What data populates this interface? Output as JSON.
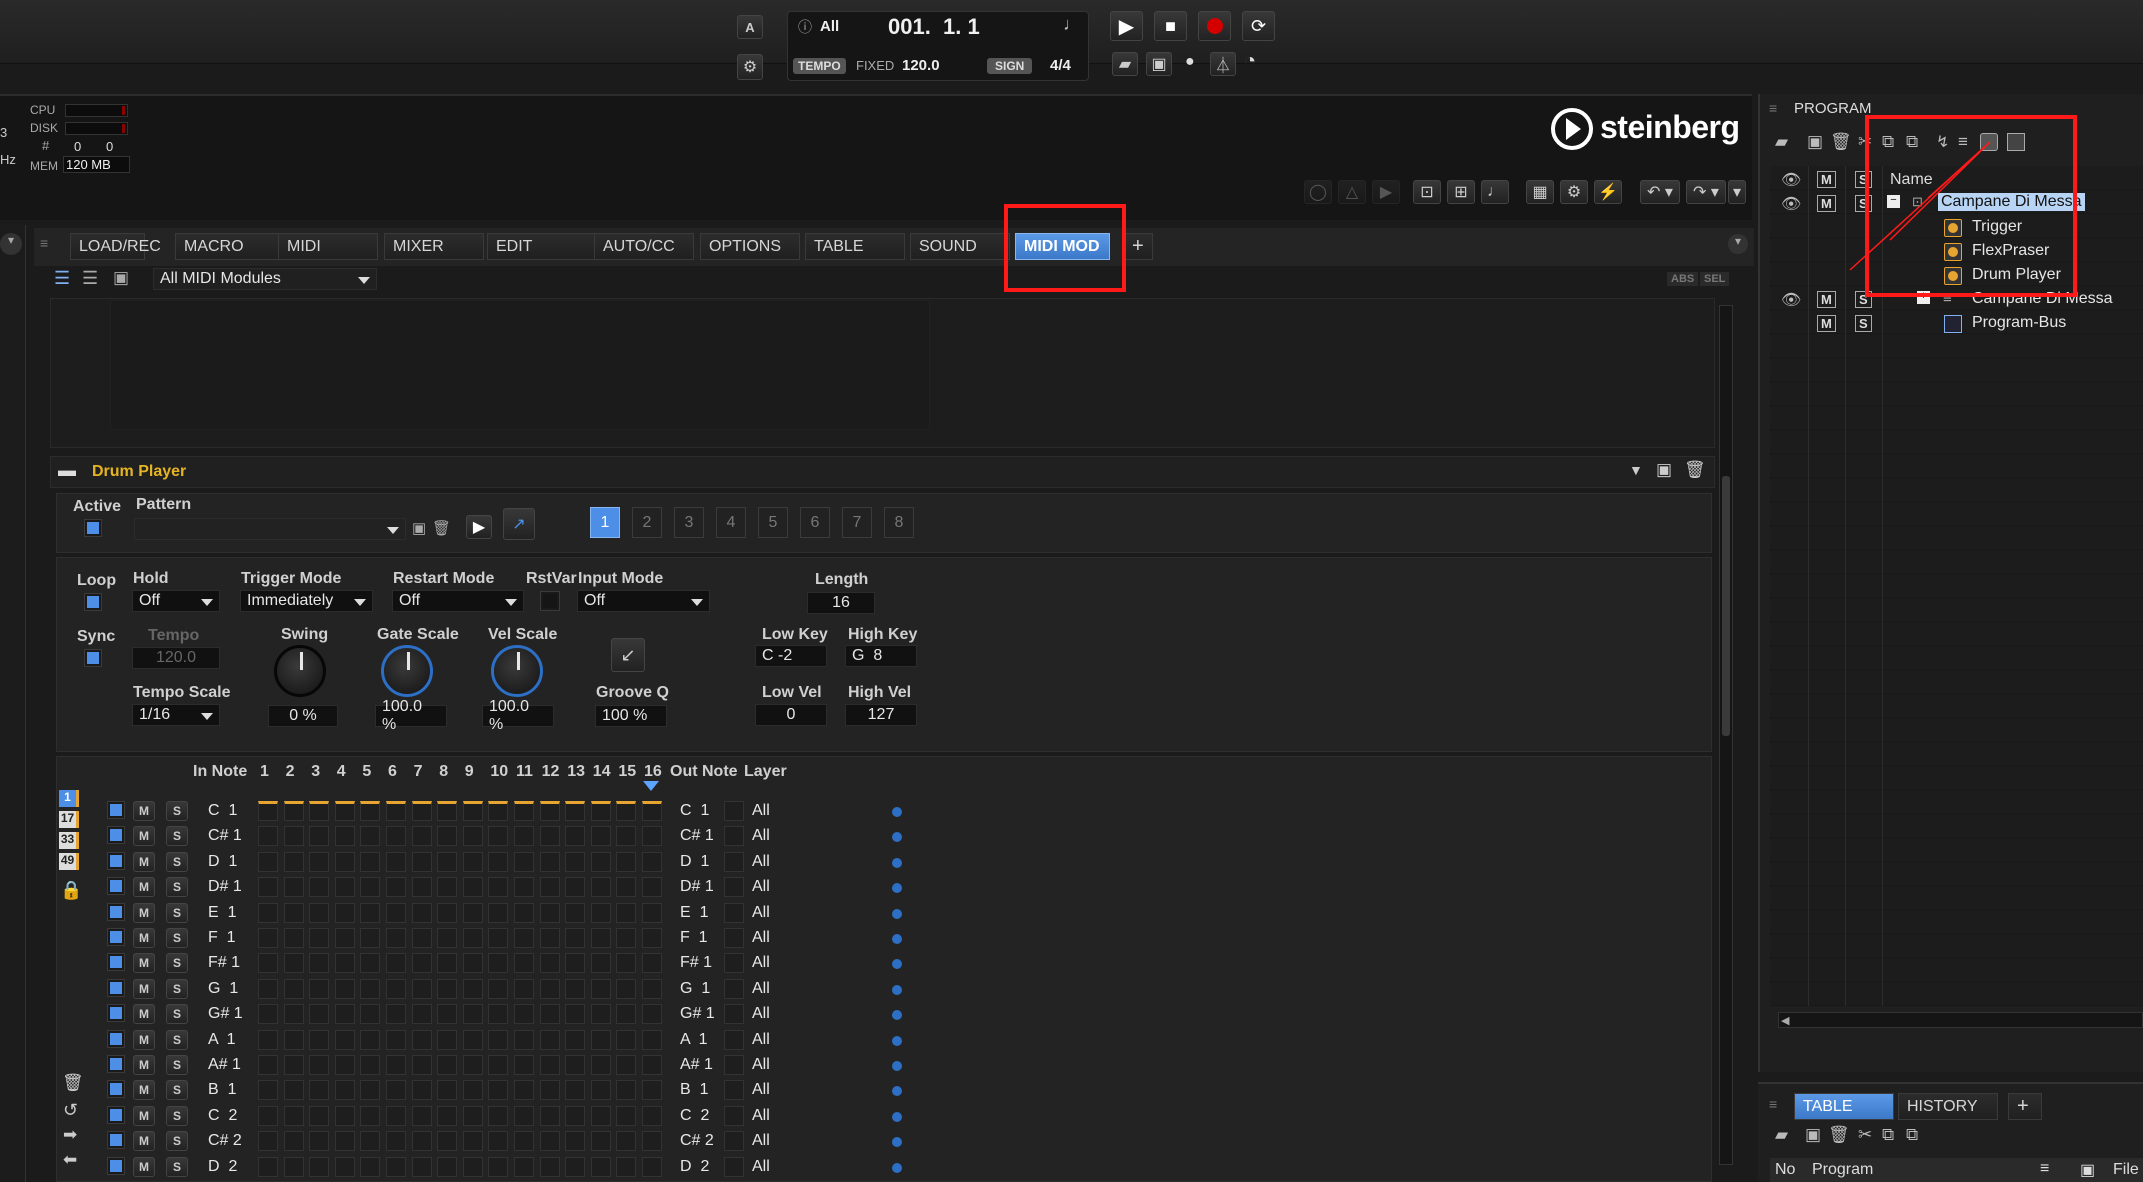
{
  "transport": {
    "mode": "All",
    "position": "001.  1. 1",
    "tempo_label": "TEMPO",
    "tempo_mode": "FIXED",
    "tempo_value": "120.0",
    "sign_label": "SIGN",
    "sign_value": "4/4",
    "a_label": "A"
  },
  "meters": {
    "cpu": "CPU",
    "disk": "DISK",
    "voices_icon": "#",
    "voices_a": "0",
    "voices_b": "0",
    "mem": "MEM",
    "mem_value": "120 MB",
    "side_a": "3",
    "side_b": "Hz"
  },
  "brand": "steinberg",
  "tabs": [
    "LOAD/REC",
    "MACRO",
    "MIDI",
    "MIXER",
    "EDIT",
    "AUTO/CC",
    "OPTIONS",
    "TABLE",
    "SOUND",
    "MIDI MOD",
    "+"
  ],
  "module_filter": "All MIDI Modules",
  "abs_label": "ABS",
  "sel_label": "SEL",
  "drum_player": {
    "title": "Drum Player",
    "active_label": "Active",
    "pattern_label": "Pattern",
    "pattern_slots": [
      "1",
      "2",
      "3",
      "4",
      "5",
      "6",
      "7",
      "8"
    ],
    "loop": "Loop",
    "hold": "Hold",
    "hold_val": "Off",
    "trigger_mode": "Trigger Mode",
    "trigger_val": "Immediately",
    "restart_mode": "Restart Mode",
    "restart_val": "Off",
    "rstvar": "RstVar",
    "input_mode": "Input Mode",
    "input_val": "Off",
    "length": "Length",
    "length_val": "16",
    "sync": "Sync",
    "tempo": "Tempo",
    "tempo_val": "120.0",
    "swing": "Swing",
    "swing_val": "0 %",
    "gate": "Gate Scale",
    "gate_val": "100.0 %",
    "vel": "Vel Scale",
    "vel_val": "100.0 %",
    "groove": "Groove Q",
    "groove_val": "100 %",
    "lowkey": "Low Key",
    "lowkey_val": "C -2",
    "highkey": "High Key",
    "highkey_val": "G  8",
    "lowvel": "Low Vel",
    "lowvel_val": "0",
    "highvel": "High Vel",
    "highvel_val": "127",
    "tempo_scale": "Tempo Scale",
    "tempo_scale_val": "1/16"
  },
  "grid": {
    "in_note": "In Note",
    "out_note": "Out Note",
    "layer": "Layer",
    "steps": [
      "1",
      "2",
      "3",
      "4",
      "5",
      "6",
      "7",
      "8",
      "9",
      "10",
      "11",
      "12",
      "13",
      "14",
      "15",
      "16"
    ],
    "pages": [
      "1",
      "17",
      "33",
      "49"
    ],
    "m": "M",
    "s": "S",
    "rows": [
      {
        "in": "C  1",
        "out": "C  1",
        "layer": "All"
      },
      {
        "in": "C# 1",
        "out": "C# 1",
        "layer": "All"
      },
      {
        "in": "D  1",
        "out": "D  1",
        "layer": "All"
      },
      {
        "in": "D# 1",
        "out": "D# 1",
        "layer": "All"
      },
      {
        "in": "E  1",
        "out": "E  1",
        "layer": "All"
      },
      {
        "in": "F  1",
        "out": "F  1",
        "layer": "All"
      },
      {
        "in": "F# 1",
        "out": "F# 1",
        "layer": "All"
      },
      {
        "in": "G  1",
        "out": "G  1",
        "layer": "All"
      },
      {
        "in": "G# 1",
        "out": "G# 1",
        "layer": "All"
      },
      {
        "in": "A  1",
        "out": "A  1",
        "layer": "All"
      },
      {
        "in": "A# 1",
        "out": "A# 1",
        "layer": "All"
      },
      {
        "in": "B  1",
        "out": "B  1",
        "layer": "All"
      },
      {
        "in": "C  2",
        "out": "C  2",
        "layer": "All"
      },
      {
        "in": "C# 2",
        "out": "C# 2",
        "layer": "All"
      },
      {
        "in": "D  2",
        "out": "D  2",
        "layer": "All"
      }
    ]
  },
  "program": {
    "title": "PROGRAM",
    "name_col": "Name",
    "m": "M",
    "s": "S",
    "tree": [
      {
        "label": "Campane Di Messa",
        "selected": true
      },
      {
        "label": "Trigger"
      },
      {
        "label": "FlexPraser"
      },
      {
        "label": "Drum Player"
      },
      {
        "label": "Campane Di Messa"
      },
      {
        "label": "Program-Bus"
      }
    ]
  },
  "bottom": {
    "tabs": [
      "TABLE",
      "HISTORY",
      "+"
    ],
    "cols": [
      "No",
      "Program",
      "File"
    ]
  }
}
